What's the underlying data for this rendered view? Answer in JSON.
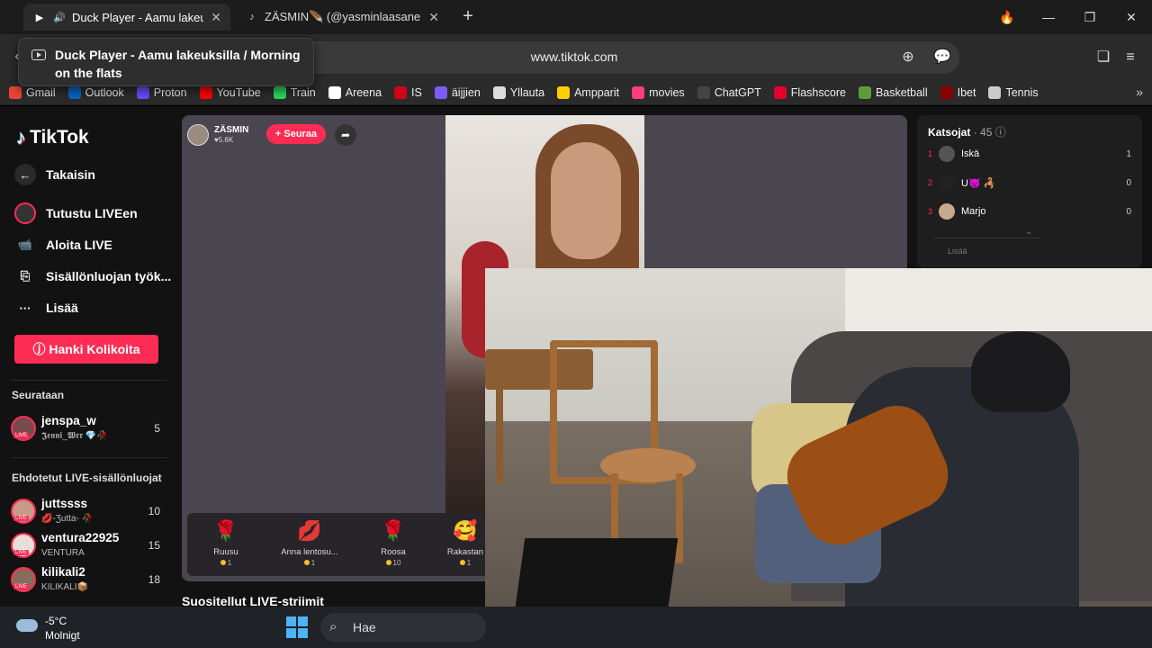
{
  "browser": {
    "tabs": [
      {
        "title": "Duck Player - Aamu lakeuk",
        "active": true
      },
      {
        "title": "ZÄSMIN🪶 (@yasminlaasanen",
        "active": false
      }
    ],
    "tooltip": "Duck Player - Aamu lakeuksilla / Morning on the flats",
    "url": "www.tiktok.com",
    "new_tab": "+",
    "bookmarks": [
      {
        "label": "Gmail",
        "color": "#ea4335"
      },
      {
        "label": "Outlook",
        "color": "#0a64c9"
      },
      {
        "label": "Proton",
        "color": "#6d4aff"
      },
      {
        "label": "YouTube",
        "color": "#ff0000"
      },
      {
        "label": "Train",
        "color": "#2bd95f"
      },
      {
        "label": "Areena",
        "color": "#ffffff"
      },
      {
        "label": "IS",
        "color": "#d0021b"
      },
      {
        "label": "äijjien",
        "color": "#7b5cff"
      },
      {
        "label": "Yllauta",
        "color": "#dddddd"
      },
      {
        "label": "Ampparit",
        "color": "#ffd000"
      },
      {
        "label": "movies",
        "color": "#ff3d7f"
      },
      {
        "label": "ChatGPT",
        "color": "#444444"
      },
      {
        "label": "Flashscore",
        "color": "#e4002b"
      },
      {
        "label": "Basketball",
        "color": "#5e9c3a"
      },
      {
        "label": "Ibet",
        "color": "#8b0000"
      },
      {
        "label": "Tennis",
        "color": "#cccccc"
      }
    ]
  },
  "tiktok": {
    "logo": "TikTok",
    "nav": [
      {
        "label": "Takaisin",
        "icon": "back-arrow-icon"
      },
      {
        "label": "Tutustu LIVEen",
        "icon": "live-explore-icon"
      },
      {
        "label": "Aloita LIVE",
        "icon": "camera-icon"
      },
      {
        "label": "Sisällönluojan työk...",
        "icon": "creator-tools-icon"
      },
      {
        "label": "Lisää",
        "icon": "more-dots-icon"
      }
    ],
    "coins_button": "Hanki Kolikoita",
    "following_title": "Seurataan",
    "following": [
      {
        "name": "jenspa_w",
        "sub": "𝕵𝖊𝖓𝖓𝖎_𝖂𝖗𝖗 💎🥀",
        "count": "5"
      }
    ],
    "suggested_title": "Ehdotetut LIVE-sisällönluojat",
    "suggested": [
      {
        "name": "juttssss",
        "sub": "💋-Ʒutta- 🥀",
        "count": "10"
      },
      {
        "name": "ventura22925",
        "sub": "VENTURA",
        "count": "15"
      },
      {
        "name": "kilikali2",
        "sub": "KILIKALI📦",
        "count": "18"
      }
    ],
    "live_tag": "LIVE",
    "streamer": {
      "name": "ZÄSMIN",
      "likes": "5.6K"
    },
    "follow_label": "+ Seuraa",
    "gifts": [
      {
        "name": "Ruusu",
        "price": "1",
        "icon": "🌹"
      },
      {
        "name": "Anna lentosu...",
        "price": "1",
        "icon": "💋"
      },
      {
        "name": "Roosa",
        "price": "10",
        "icon": "🌹"
      },
      {
        "name": "Rakastan",
        "price": "1",
        "icon": "🥰"
      }
    ],
    "recommended_title": "Suositellut LIVE-striimit",
    "viewers": {
      "title": "Katsojat",
      "count": "· 45",
      "rows": [
        {
          "rank": "1",
          "name": "Iskä",
          "score": "1"
        },
        {
          "rank": "2",
          "name": "U👿 🦂",
          "score": "0"
        },
        {
          "rank": "3",
          "name": "Marjo",
          "score": "0"
        }
      ],
      "more": "Lisää"
    }
  },
  "taskbar": {
    "temp": "-5°C",
    "weather": "Molnigt",
    "search_placeholder": "Hae"
  }
}
